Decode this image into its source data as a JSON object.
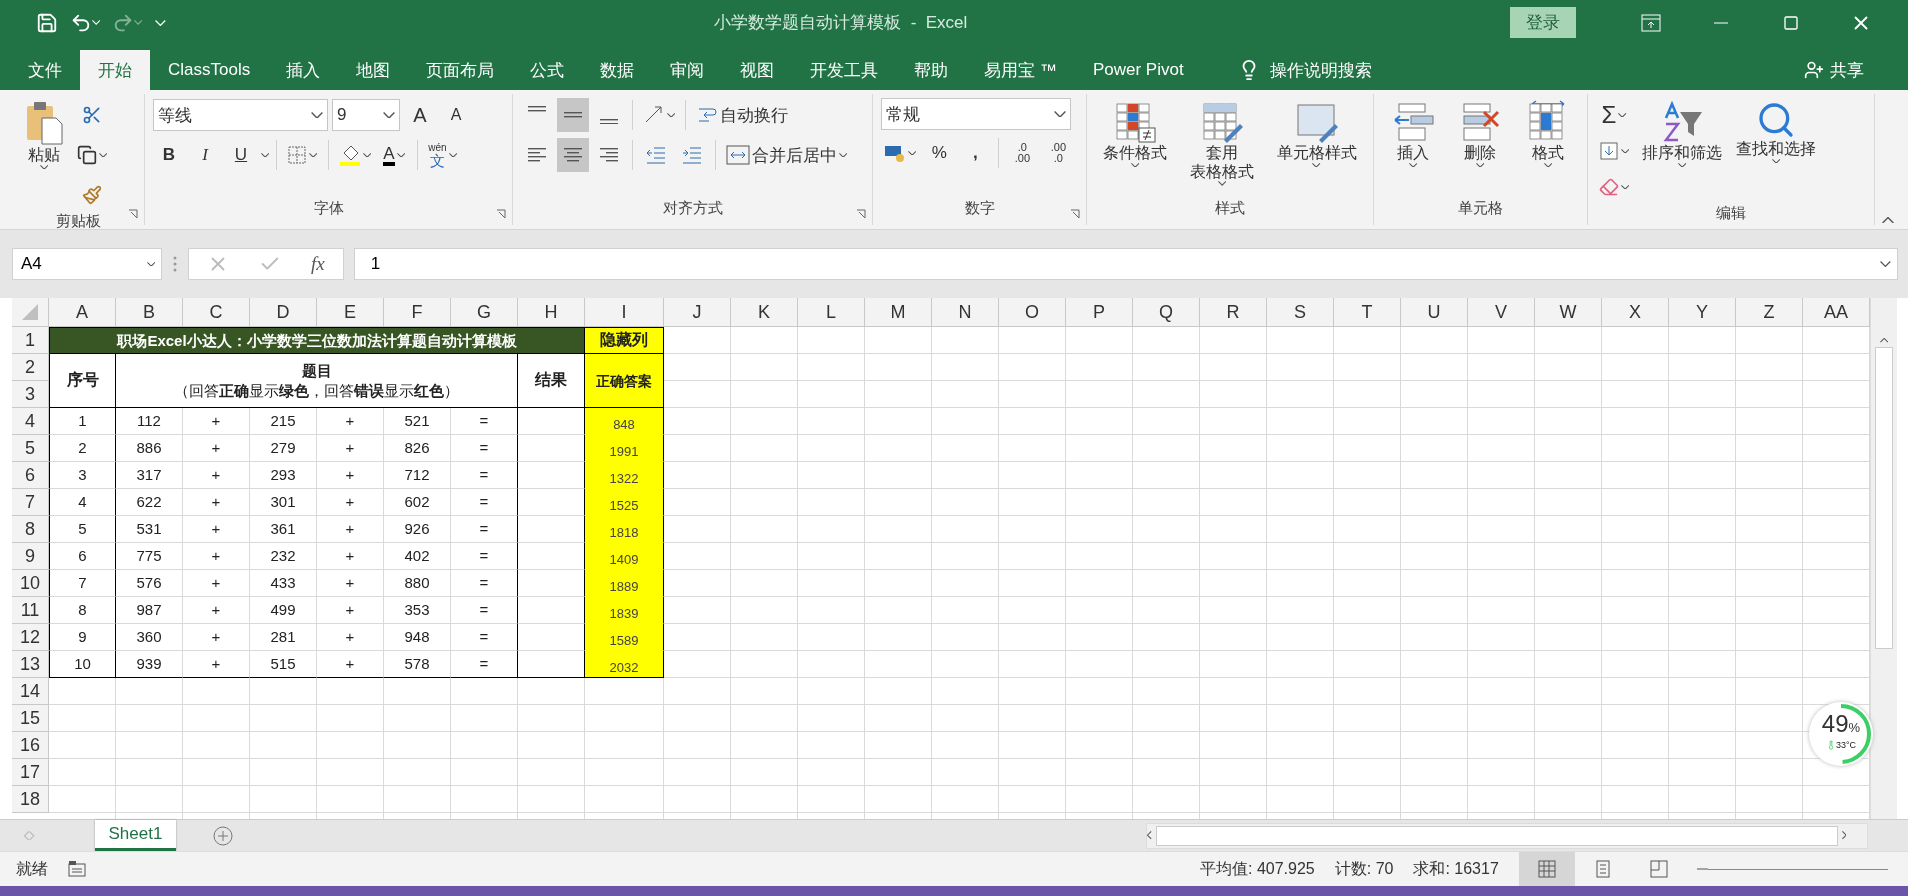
{
  "window": {
    "title": "小学数学题自动计算模板  -  Excel",
    "login": "登录"
  },
  "menu_tabs": [
    {
      "label": "文件",
      "selected": false
    },
    {
      "label": "开始",
      "selected": true
    },
    {
      "label": "ClassTools",
      "selected": false
    },
    {
      "label": "插入",
      "selected": false
    },
    {
      "label": "地图",
      "selected": false
    },
    {
      "label": "页面布局",
      "selected": false
    },
    {
      "label": "公式",
      "selected": false
    },
    {
      "label": "数据",
      "selected": false
    },
    {
      "label": "审阅",
      "selected": false
    },
    {
      "label": "视图",
      "selected": false
    },
    {
      "label": "开发工具",
      "selected": false
    },
    {
      "label": "帮助",
      "selected": false
    },
    {
      "label": "易用宝 ™",
      "selected": false
    },
    {
      "label": "Power Pivot",
      "selected": false
    }
  ],
  "tell_me": "操作说明搜索",
  "share": "共享",
  "ribbon": {
    "clipboard": {
      "label": "剪贴板",
      "paste": "粘贴"
    },
    "font": {
      "label": "字体",
      "font_name": "等线",
      "font_size": "9",
      "grow": "A",
      "shrink": "A",
      "bold": "B",
      "italic": "I",
      "underline": "U",
      "font_color": "A",
      "phonetic_top": "wén",
      "phonetic_bottom": "文"
    },
    "alignment": {
      "label": "对齐方式",
      "vertical": [
        {
          "selected": false
        },
        {
          "selected": true
        },
        {
          "selected": false
        }
      ],
      "horizontal": [
        {
          "selected": false
        },
        {
          "selected": true
        },
        {
          "selected": false
        }
      ],
      "wrap_text": "自动换行",
      "merge_center": "合并后居中"
    },
    "number": {
      "label": "数字",
      "format": "常规",
      "percent": "%",
      "comma": ",",
      "increase_decimal": [
        ".0",
        ".00"
      ],
      "decrease_decimal": [
        ".00",
        ".0"
      ]
    },
    "styles": {
      "label": "样式",
      "buttons": [
        {
          "kind": "conditional",
          "lines": [
            "条件格式"
          ]
        },
        {
          "kind": "table",
          "lines": [
            "套用",
            "表格格式"
          ]
        },
        {
          "kind": "cellstyle",
          "lines": [
            "单元格样式"
          ]
        }
      ]
    },
    "cells": {
      "label": "单元格",
      "buttons": [
        {
          "kind": "insert",
          "lines": [
            "插入"
          ]
        },
        {
          "kind": "delete",
          "lines": [
            "删除"
          ]
        },
        {
          "kind": "format",
          "lines": [
            "格式"
          ]
        }
      ]
    },
    "editing": {
      "label": "编辑",
      "sum": "Σ",
      "buttons": [
        {
          "kind": "sort",
          "lines": [
            "排序和筛选"
          ]
        },
        {
          "kind": "find",
          "lines": [
            "查找和选择"
          ]
        }
      ]
    }
  },
  "formula_bar": {
    "name_box": "A4",
    "fx": "fx",
    "value": "1"
  },
  "sheet": {
    "columns": [
      "A",
      "B",
      "C",
      "D",
      "E",
      "F",
      "G",
      "H",
      "I",
      "J",
      "K",
      "L",
      "M",
      "N",
      "O",
      "P",
      "Q",
      "R",
      "S",
      "T",
      "U",
      "V",
      "W",
      "X",
      "Y",
      "Z",
      "AA"
    ],
    "row_numbers": [
      "1",
      "2",
      "3",
      "4",
      "5",
      "6",
      "7",
      "8",
      "9",
      "10",
      "11",
      "12",
      "13",
      "14",
      "15",
      "16",
      "17",
      "18"
    ],
    "title": "职场Excel小达人：小学数学三位数加法计算题自动计算模板",
    "hidden_header": "隐藏列",
    "headers": {
      "index": "序号",
      "question": "题目",
      "question_note": "（回答**正确**显示**绿色**，回答**错误**显示**红色**）",
      "result": "结果",
      "answer": "正确答案"
    },
    "rows": [
      {
        "values": [
          "1",
          "112",
          "+",
          "215",
          "+",
          "521",
          "="
        ],
        "answer": "848"
      },
      {
        "values": [
          "2",
          "886",
          "+",
          "279",
          "+",
          "826",
          "="
        ],
        "answer": "1991"
      },
      {
        "values": [
          "3",
          "317",
          "+",
          "293",
          "+",
          "712",
          "="
        ],
        "answer": "1322"
      },
      {
        "values": [
          "4",
          "622",
          "+",
          "301",
          "+",
          "602",
          "="
        ],
        "answer": "1525"
      },
      {
        "values": [
          "5",
          "531",
          "+",
          "361",
          "+",
          "926",
          "="
        ],
        "answer": "1818"
      },
      {
        "values": [
          "6",
          "775",
          "+",
          "232",
          "+",
          "402",
          "="
        ],
        "answer": "1409"
      },
      {
        "values": [
          "7",
          "576",
          "+",
          "433",
          "+",
          "880",
          "="
        ],
        "answer": "1889"
      },
      {
        "values": [
          "8",
          "987",
          "+",
          "499",
          "+",
          "353",
          "="
        ],
        "answer": "1839"
      },
      {
        "values": [
          "9",
          "360",
          "+",
          "281",
          "+",
          "948",
          "="
        ],
        "answer": "1589"
      },
      {
        "values": [
          "10",
          "939",
          "+",
          "515",
          "+",
          "578",
          "="
        ],
        "answer": "2032"
      }
    ]
  },
  "sheet_tabs": [
    {
      "label": "Sheet1",
      "selected": true
    }
  ],
  "status": {
    "ready": "就绪",
    "average": "平均值: 407.925",
    "count": "计数: 70",
    "sum": "求和: 16317"
  },
  "monitor": {
    "value": "49",
    "unit": "%",
    "temp": "33°C",
    "level": 0.49
  }
}
